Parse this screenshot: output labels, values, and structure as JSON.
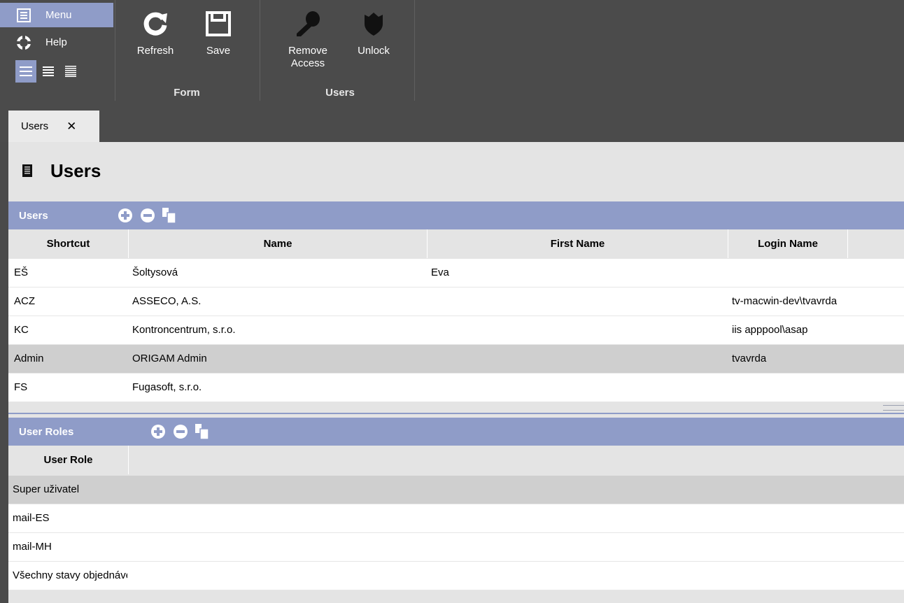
{
  "ribbon": {
    "menu_label": "Menu",
    "help_label": "Help",
    "refresh_label": "Refresh",
    "save_label": "Save",
    "remove_access_label": "Remove Access",
    "unlock_label": "Unlock",
    "group_form": "Form",
    "group_users": "Users"
  },
  "tab": {
    "label": "Users",
    "close": "✕"
  },
  "page": {
    "title": "Users"
  },
  "users_panel": {
    "title": "Users",
    "columns": [
      "Shortcut",
      "Name",
      "First Name",
      "Login Name"
    ],
    "rows": [
      {
        "shortcut": "EŠ",
        "name": "Šoltysová",
        "first_name": "Eva",
        "login": ""
      },
      {
        "shortcut": "ACZ",
        "name": "ASSECO, A.S.",
        "first_name": "",
        "login": "tv-macwin-dev\\tvavrda"
      },
      {
        "shortcut": "KC",
        "name": "Kontroncentrum, s.r.o.",
        "first_name": "",
        "login": "iis apppool\\asap"
      },
      {
        "shortcut": "Admin",
        "name": "ORIGAM Admin",
        "first_name": "",
        "login": "tvavrda"
      },
      {
        "shortcut": "FS",
        "name": "Fugasoft, s.r.o.",
        "first_name": "",
        "login": ""
      }
    ]
  },
  "roles_panel": {
    "title": "User Roles",
    "columns": [
      "User Role"
    ],
    "rows": [
      {
        "role": "Super uživatel"
      },
      {
        "role": "mail-ES"
      },
      {
        "role": "mail-MH"
      },
      {
        "role": "Všechny stavy objednávek"
      }
    ]
  },
  "colors": {
    "accent": "#8f9cc8",
    "ribbon": "#4b4b4b",
    "selected_row": "#cfcfcf"
  }
}
